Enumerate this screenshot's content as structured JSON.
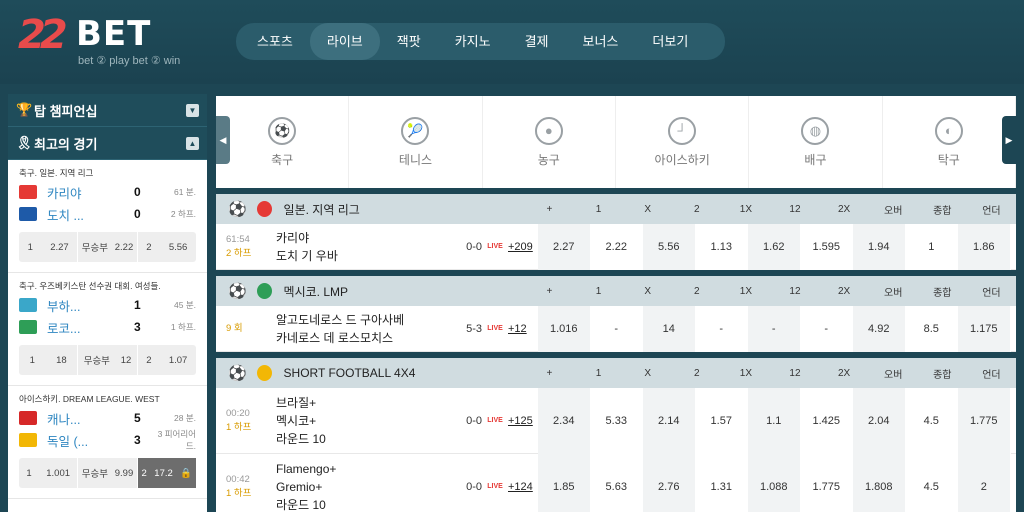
{
  "header": {
    "logo": {
      "num": "22",
      "brand": "BET",
      "tagline": "bet ② play  bet ② win"
    },
    "nav": [
      "스포츠",
      "라이브",
      "잭팟",
      "카지노",
      "결제",
      "보너스",
      "더보기"
    ]
  },
  "sidebar": {
    "sections": [
      {
        "title": "탑 챔피언십",
        "toggle": "▼"
      },
      {
        "title": "최고의 경기",
        "toggle": "▲"
      }
    ],
    "matches": [
      {
        "caption": "축구. 일본. 지역 리그",
        "teams": [
          {
            "name": "카리야",
            "score": "0",
            "time": "61 분.",
            "flag": "#e53935"
          },
          {
            "name": "도치 ...",
            "score": "0",
            "time": "2 하프.",
            "flag": "#1e5aa8"
          }
        ],
        "odds": [
          [
            "1",
            "2.27"
          ],
          [
            "무승부",
            "2.22"
          ],
          [
            "2",
            "5.56"
          ]
        ]
      },
      {
        "caption": "축구. 우즈베키스탄 선수권 대회. 여성들.",
        "teams": [
          {
            "name": "부하...",
            "score": "1",
            "time": "45 분.",
            "flag": "#3aa7c9"
          },
          {
            "name": "로코...",
            "score": "3",
            "time": "1 하프.",
            "flag": "#2e9e57"
          }
        ],
        "odds": [
          [
            "1",
            "18"
          ],
          [
            "무승부",
            "12"
          ],
          [
            "2",
            "1.07"
          ]
        ]
      },
      {
        "caption": "아이스하키. DREAM LEAGUE. WEST",
        "teams": [
          {
            "name": "캐나...",
            "score": "5",
            "time": "28 분.",
            "flag": "#d62828"
          },
          {
            "name": "독일 (...",
            "score": "3",
            "time": "3 피어리어드.",
            "flag": "#f2b705"
          }
        ],
        "odds": [
          [
            "1",
            "1.001"
          ],
          [
            "무승부",
            "9.99"
          ],
          [
            "2",
            "17.2"
          ]
        ]
      }
    ]
  },
  "sports": [
    {
      "label": "축구",
      "icon": "soccer-ball-icon",
      "glyph": "⚽"
    },
    {
      "label": "테니스",
      "icon": "tennis-racket-icon",
      "glyph": "🎾"
    },
    {
      "label": "농구",
      "icon": "basketball-icon",
      "glyph": "●"
    },
    {
      "label": "아이스하키",
      "icon": "hockey-stick-icon",
      "glyph": "┘"
    },
    {
      "label": "배구",
      "icon": "volleyball-icon",
      "glyph": "◍"
    },
    {
      "label": "탁구",
      "icon": "table-tennis-icon",
      "glyph": "◐"
    }
  ],
  "columns": [
    "+",
    "1",
    "X",
    "2",
    "1X",
    "12",
    "2X",
    "오버",
    "종합",
    "언더"
  ],
  "leagues": [
    {
      "name": "일본. 지역 리그",
      "flag": "#e53935",
      "rows": [
        {
          "time": "61:54",
          "period": "2 하프",
          "teams": [
            "카리야",
            "도치 기 우바"
          ],
          "score": "0-0",
          "live": "LIVE",
          "plus": "+209",
          "odds": [
            "2.27",
            "2.22",
            "5.56",
            "1.13",
            "1.62",
            "1.595",
            "1.94",
            "1",
            "1.86"
          ]
        }
      ]
    },
    {
      "name": "멕시코. LMP",
      "flag": "#2e9e57",
      "rows": [
        {
          "time": "",
          "period": "9 회",
          "teams": [
            "알고도네로스 드 구아사베",
            "카네로스 데 로스모치스"
          ],
          "score": "5-3",
          "live": "LIVE",
          "plus": "+12",
          "odds": [
            "1.016",
            "-",
            "14",
            "-",
            "-",
            "-",
            "4.92",
            "8.5",
            "1.175"
          ]
        }
      ]
    },
    {
      "name": "SHORT FOOTBALL 4X4",
      "flag": "#f2b705",
      "rows": [
        {
          "time": "00:20",
          "period": "1 하프",
          "teams": [
            "브라질+",
            "멕시코+",
            "라운드 10"
          ],
          "score": "0-0",
          "live": "LIVE",
          "plus": "+125",
          "odds": [
            "2.34",
            "5.33",
            "2.14",
            "1.57",
            "1.1",
            "1.425",
            "2.04",
            "4.5",
            "1.775"
          ]
        },
        {
          "time": "00:42",
          "period": "1 하프",
          "teams": [
            "Flamengo+",
            "Gremio+",
            "라운드 10"
          ],
          "score": "0-0",
          "live": "LIVE",
          "plus": "+124",
          "odds": [
            "1.85",
            "5.63",
            "2.76",
            "1.31",
            "1.088",
            "1.775",
            "1.808",
            "4.5",
            "2"
          ]
        }
      ]
    }
  ]
}
